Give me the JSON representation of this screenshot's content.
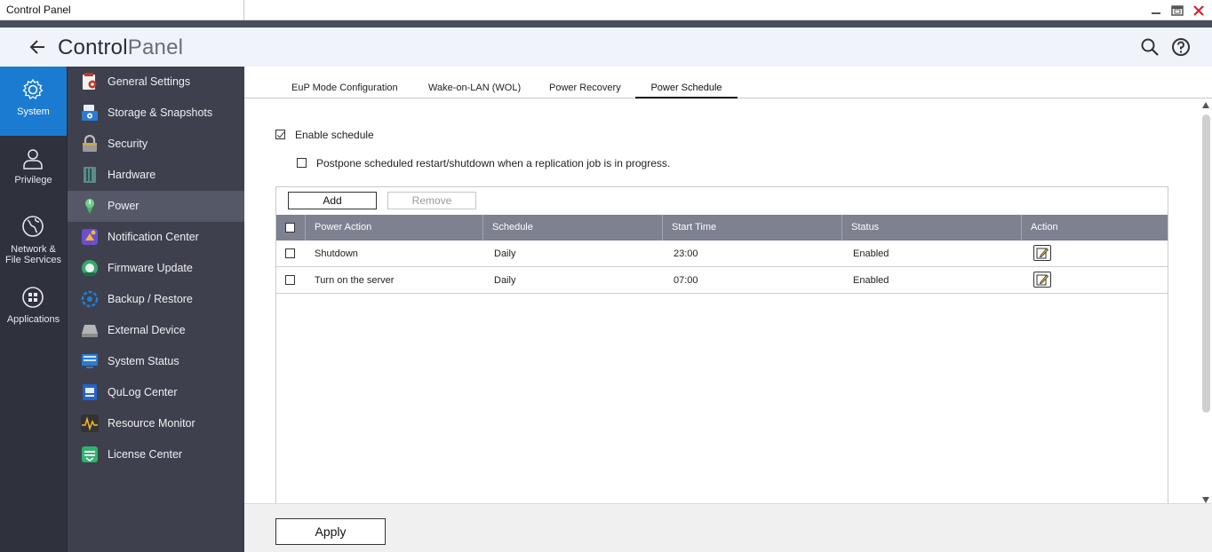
{
  "window": {
    "title": "Control Panel"
  },
  "header": {
    "title_bold": "Control",
    "title_light": "Panel"
  },
  "rail": [
    {
      "label": "System",
      "icon": "gear-icon",
      "active": true
    },
    {
      "label": "Privilege",
      "icon": "user-icon",
      "active": false
    },
    {
      "label": "Network &\nFile Services",
      "icon": "globe-icon",
      "active": false
    },
    {
      "label": "Applications",
      "icon": "apps-grid-icon",
      "active": false
    }
  ],
  "subnav": [
    {
      "label": "General Settings",
      "icon": "general-settings-icon",
      "color": "#c0392b"
    },
    {
      "label": "Storage & Snapshots",
      "icon": "storage-icon",
      "color": "#2b7bd1"
    },
    {
      "label": "Security",
      "icon": "lock-icon",
      "color": "#9a9a9a"
    },
    {
      "label": "Hardware",
      "icon": "hardware-icon",
      "color": "#5a8c8a"
    },
    {
      "label": "Power",
      "icon": "power-icon",
      "color": "#4bb36a",
      "active": true
    },
    {
      "label": "Notification Center",
      "icon": "notification-icon",
      "color": "#6a4fd1"
    },
    {
      "label": "Firmware Update",
      "icon": "firmware-icon",
      "color": "#3aa76d"
    },
    {
      "label": "Backup / Restore",
      "icon": "backup-icon",
      "color": "#1f80d8"
    },
    {
      "label": "External Device",
      "icon": "external-device-icon",
      "color": "#9a9a9a"
    },
    {
      "label": "System Status",
      "icon": "system-status-icon",
      "color": "#2b7bd1"
    },
    {
      "label": "QuLog Center",
      "icon": "qulog-icon",
      "color": "#2563c8"
    },
    {
      "label": "Resource Monitor",
      "icon": "resource-monitor-icon",
      "color": "#333333"
    },
    {
      "label": "License Center",
      "icon": "license-icon",
      "color": "#2fb36a"
    }
  ],
  "tabs": [
    {
      "label": "EuP Mode Configuration",
      "active": false
    },
    {
      "label": "Wake-on-LAN (WOL)",
      "active": false
    },
    {
      "label": "Power Recovery",
      "active": false
    },
    {
      "label": "Power Schedule",
      "active": true
    }
  ],
  "schedule": {
    "enable_label": "Enable schedule",
    "enable_checked": true,
    "postpone_label": "Postpone scheduled restart/shutdown when a replication job is in progress.",
    "postpone_checked": false,
    "add_label": "Add",
    "remove_label": "Remove"
  },
  "table": {
    "columns": [
      "Power Action",
      "Schedule",
      "Start Time",
      "Status",
      "Action"
    ],
    "rows": [
      {
        "power_action": "Shutdown",
        "schedule": "Daily",
        "start_time": "23:00",
        "status": "Enabled"
      },
      {
        "power_action": "Turn on the server",
        "schedule": "Daily",
        "start_time": "07:00",
        "status": "Enabled"
      }
    ]
  },
  "footer": {
    "apply_label": "Apply"
  },
  "colors": {
    "accent": "#1b7bd1",
    "rail_bg": "#2f313d",
    "subnav_bg": "#3e404d",
    "table_header": "#7d8190",
    "close": "#d8232a"
  }
}
